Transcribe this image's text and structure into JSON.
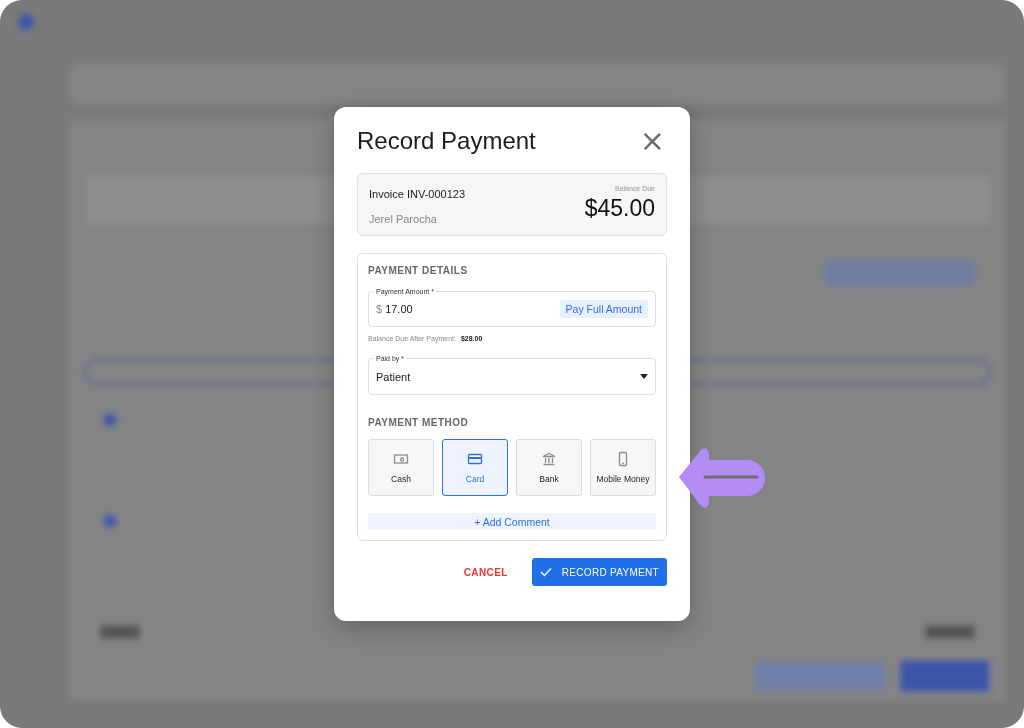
{
  "dialog": {
    "title": "Record Payment",
    "close": "×"
  },
  "invoice": {
    "number": "Invoice INV-000123",
    "patient": "Jerel Parocha",
    "balance_label": "Balance Due",
    "balance": "$45.00"
  },
  "details": {
    "heading": "PAYMENT DETAILS",
    "amount": {
      "label": "Payment Amount *",
      "currency": "$",
      "value": "17.00",
      "action": "Pay Full Amount"
    },
    "after": {
      "label": "Balance Due After Payment:",
      "value": "$28.00"
    },
    "paid_by": {
      "label": "Paid by *",
      "value": "Patient"
    }
  },
  "method": {
    "heading": "PAYMENT METHOD",
    "options": [
      {
        "kind": "cash",
        "label": "Cash",
        "selected": false
      },
      {
        "kind": "card",
        "label": "Card",
        "selected": true
      },
      {
        "kind": "bank",
        "label": "Bank",
        "selected": false
      },
      {
        "kind": "mobile",
        "label": "Mobile Money",
        "selected": false
      }
    ]
  },
  "add_comment": {
    "icon": "+",
    "label": "Add Comment"
  },
  "buttons": {
    "cancel": "CANCEL",
    "confirm": "RECORD PAYMENT"
  }
}
